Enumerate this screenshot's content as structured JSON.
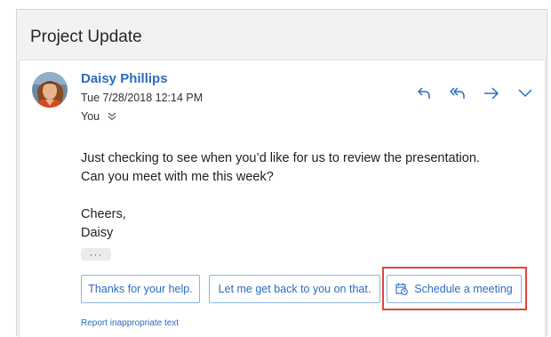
{
  "email": {
    "subject": "Project Update",
    "sender": "Daisy Phillips",
    "datetime": "Tue 7/28/2018 12:14 PM",
    "recipient": "You",
    "body_lines": [
      "Just checking to see when you’d like for us to review the presentation.",
      "Can you meet with me this week?",
      "",
      "Cheers,",
      "Daisy"
    ],
    "ellipsis_label": "···"
  },
  "suggested_replies": [
    {
      "label": "Thanks for your help."
    },
    {
      "label": "Let me get back to you on that."
    },
    {
      "label": "Schedule a meeting",
      "icon": "calendar-clock-icon",
      "highlighted": true
    }
  ],
  "report_link": "Report inappropriate text",
  "actions": [
    {
      "name": "reply-button",
      "icon": "reply-icon"
    },
    {
      "name": "reply-all-button",
      "icon": "reply-all-icon"
    },
    {
      "name": "forward-button",
      "icon": "forward-arrow-icon"
    },
    {
      "name": "more-actions-button",
      "icon": "chevron-down-icon"
    }
  ],
  "colors": {
    "accent": "#2b6cc0",
    "highlight_border": "#e0453a",
    "reading_pane_bg": "#f3f2f1"
  }
}
